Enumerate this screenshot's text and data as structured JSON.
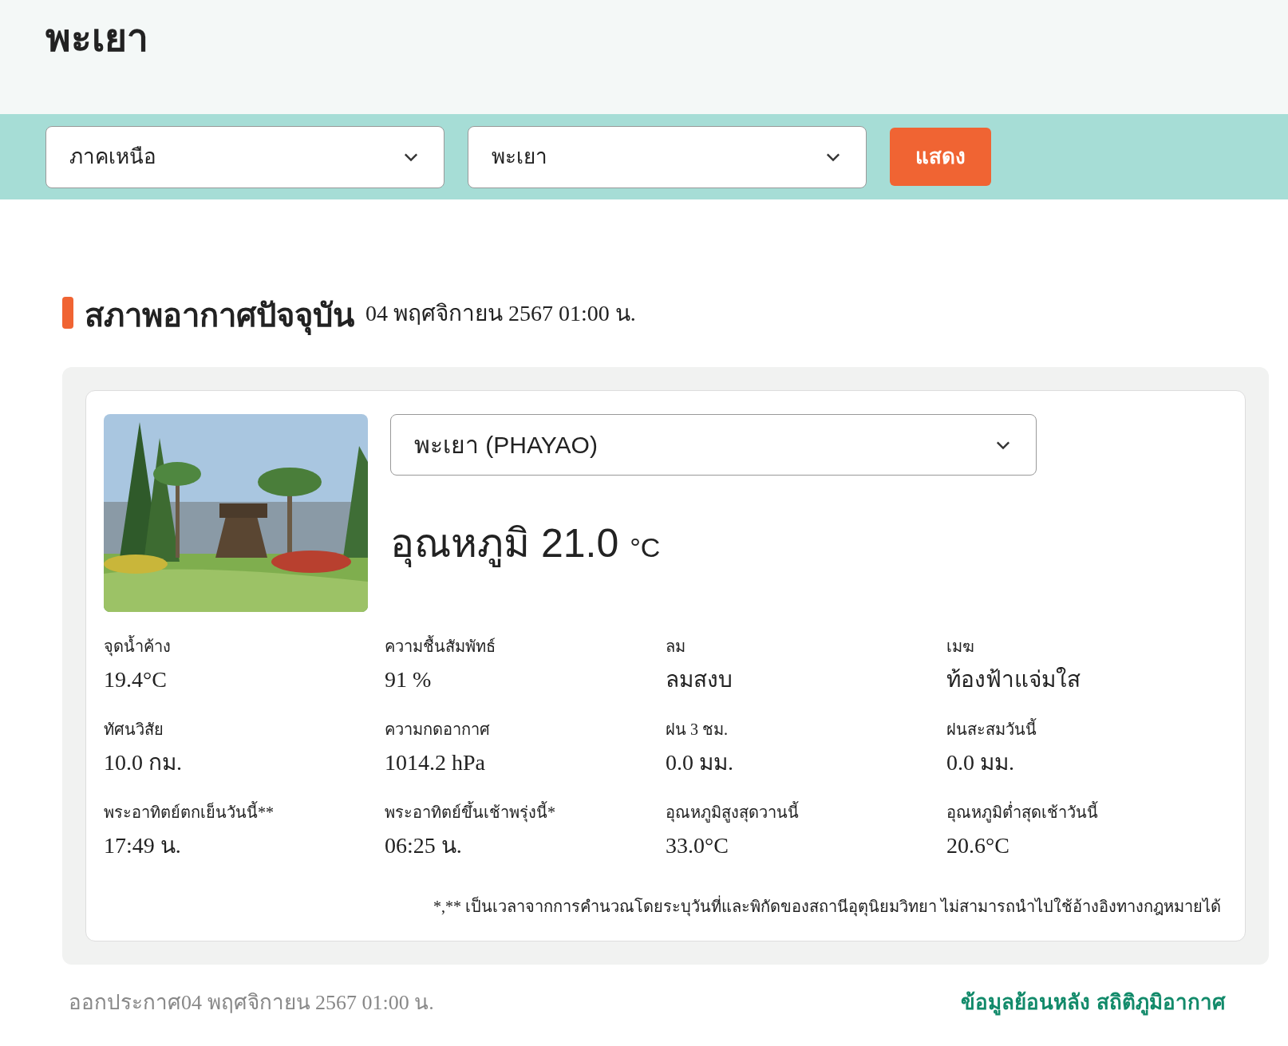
{
  "page_title": "พะเยา",
  "filters": [
    {
      "value": "ภาคเหนือ"
    },
    {
      "value": "พะเยา"
    }
  ],
  "show_button": "แสดง",
  "section": {
    "title": "สภาพอากาศปัจจุบัน",
    "datetime": "04 พฤศจิกายน 2567 01:00 น."
  },
  "station_select": "พะเยา (PHAYAO)",
  "temperature": {
    "label": "อุณหภูมิ",
    "value": "21.0",
    "unit": "°C"
  },
  "stats": [
    {
      "label": "จุดน้ำค้าง",
      "value": "19.4°C"
    },
    {
      "label": "ความชื้นสัมพัทธ์",
      "value": "91 %"
    },
    {
      "label": "ลม",
      "value": "ลมสงบ"
    },
    {
      "label": "เมฆ",
      "value": "ท้องฟ้าแจ่มใส"
    },
    {
      "label": "ทัศนวิสัย",
      "value": "10.0 กม."
    },
    {
      "label": "ความกดอากาศ",
      "value": "1014.2 hPa"
    },
    {
      "label": "ฝน 3 ชม.",
      "value": "0.0 มม."
    },
    {
      "label": "ฝนสะสมวันนี้",
      "value": "0.0 มม."
    },
    {
      "label": "พระอาทิตย์ตกเย็นวันนี้**",
      "value": "17:49 น."
    },
    {
      "label": "พระอาทิตย์ขึ้นเช้าพรุ่งนี้*",
      "value": "06:25 น."
    },
    {
      "label": "อุณหภูมิสูงสุดวานนี้",
      "value": "33.0°C"
    },
    {
      "label": "อุณหภูมิต่ำสุดเช้าวันนี้",
      "value": "20.6°C"
    }
  ],
  "note": "*,** เป็นเวลาจากการคำนวณโดยระบุวันที่และพิกัดของสถานีอุตุนิยมวิทยา ไม่สามารถนำไปใช้อ้างอิงทางกฎหมายได้",
  "footer": {
    "issued": "ออกประกาศ04 พฤศจิกายน 2567 01:00 น.",
    "links": [
      "ข้อมูลย้อนหลัง",
      "สถิติภูมิอากาศ"
    ]
  }
}
